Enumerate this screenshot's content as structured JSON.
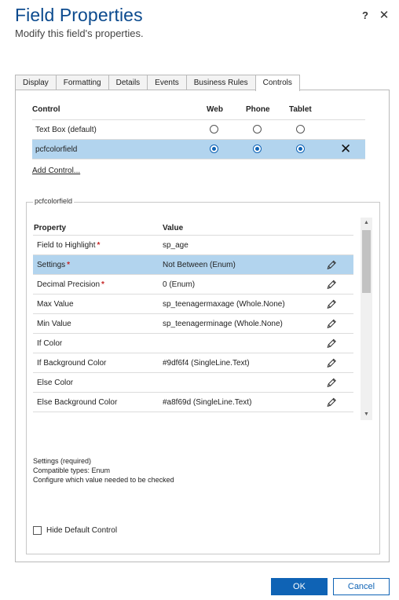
{
  "dialog": {
    "title": "Field Properties",
    "subtitle": "Modify this field's properties.",
    "help_label": "?",
    "close_label": "✕"
  },
  "tabs": [
    {
      "label": "Display"
    },
    {
      "label": "Formatting"
    },
    {
      "label": "Details"
    },
    {
      "label": "Events"
    },
    {
      "label": "Business Rules"
    },
    {
      "label": "Controls"
    }
  ],
  "active_tab": "Controls",
  "controls_table": {
    "headers": {
      "control": "Control",
      "web": "Web",
      "phone": "Phone",
      "tablet": "Tablet"
    },
    "rows": [
      {
        "name": "Text Box (default)",
        "web": false,
        "phone": false,
        "tablet": false,
        "selected": false
      },
      {
        "name": "pcfcolorfield",
        "web": true,
        "phone": true,
        "tablet": true,
        "selected": true,
        "remove_label": "✕"
      }
    ],
    "add_control_label": "Add Control..."
  },
  "properties_section": {
    "legend": "pcfcolorfield",
    "headers": {
      "property": "Property",
      "value": "Value"
    },
    "required_marker": "*",
    "rows": [
      {
        "property": "Field to Highlight",
        "required": true,
        "value": "sp_age",
        "editable": false
      },
      {
        "property": "Settings",
        "required": true,
        "value": "Not Between (Enum)",
        "editable": true,
        "selected": true
      },
      {
        "property": "Decimal Precision",
        "required": true,
        "value": "0 (Enum)",
        "editable": true
      },
      {
        "property": "Max Value",
        "required": false,
        "value": "sp_teenagermaxage (Whole.None)",
        "editable": true
      },
      {
        "property": "Min Value",
        "required": false,
        "value": "sp_teenagerminage (Whole.None)",
        "editable": true
      },
      {
        "property": "If Color",
        "required": false,
        "value": "",
        "editable": true
      },
      {
        "property": "If Background Color",
        "required": false,
        "value": "#9df6f4 (SingleLine.Text)",
        "editable": true
      },
      {
        "property": "Else Color",
        "required": false,
        "value": "",
        "editable": true
      },
      {
        "property": "Else Background Color",
        "required": false,
        "value": "#a8f69d (SingleLine.Text)",
        "editable": true
      }
    ],
    "description": [
      "Settings (required)",
      "Compatible types: Enum",
      "Configure which value needed to be checked"
    ],
    "hide_default_label": "Hide Default Control",
    "hide_default_checked": false
  },
  "footer": {
    "ok_label": "OK",
    "cancel_label": "Cancel"
  },
  "colors": {
    "title": "#0b4a8e",
    "primary": "#0f63b5",
    "selected_row": "#b2d4ee",
    "required": "#c62828"
  }
}
